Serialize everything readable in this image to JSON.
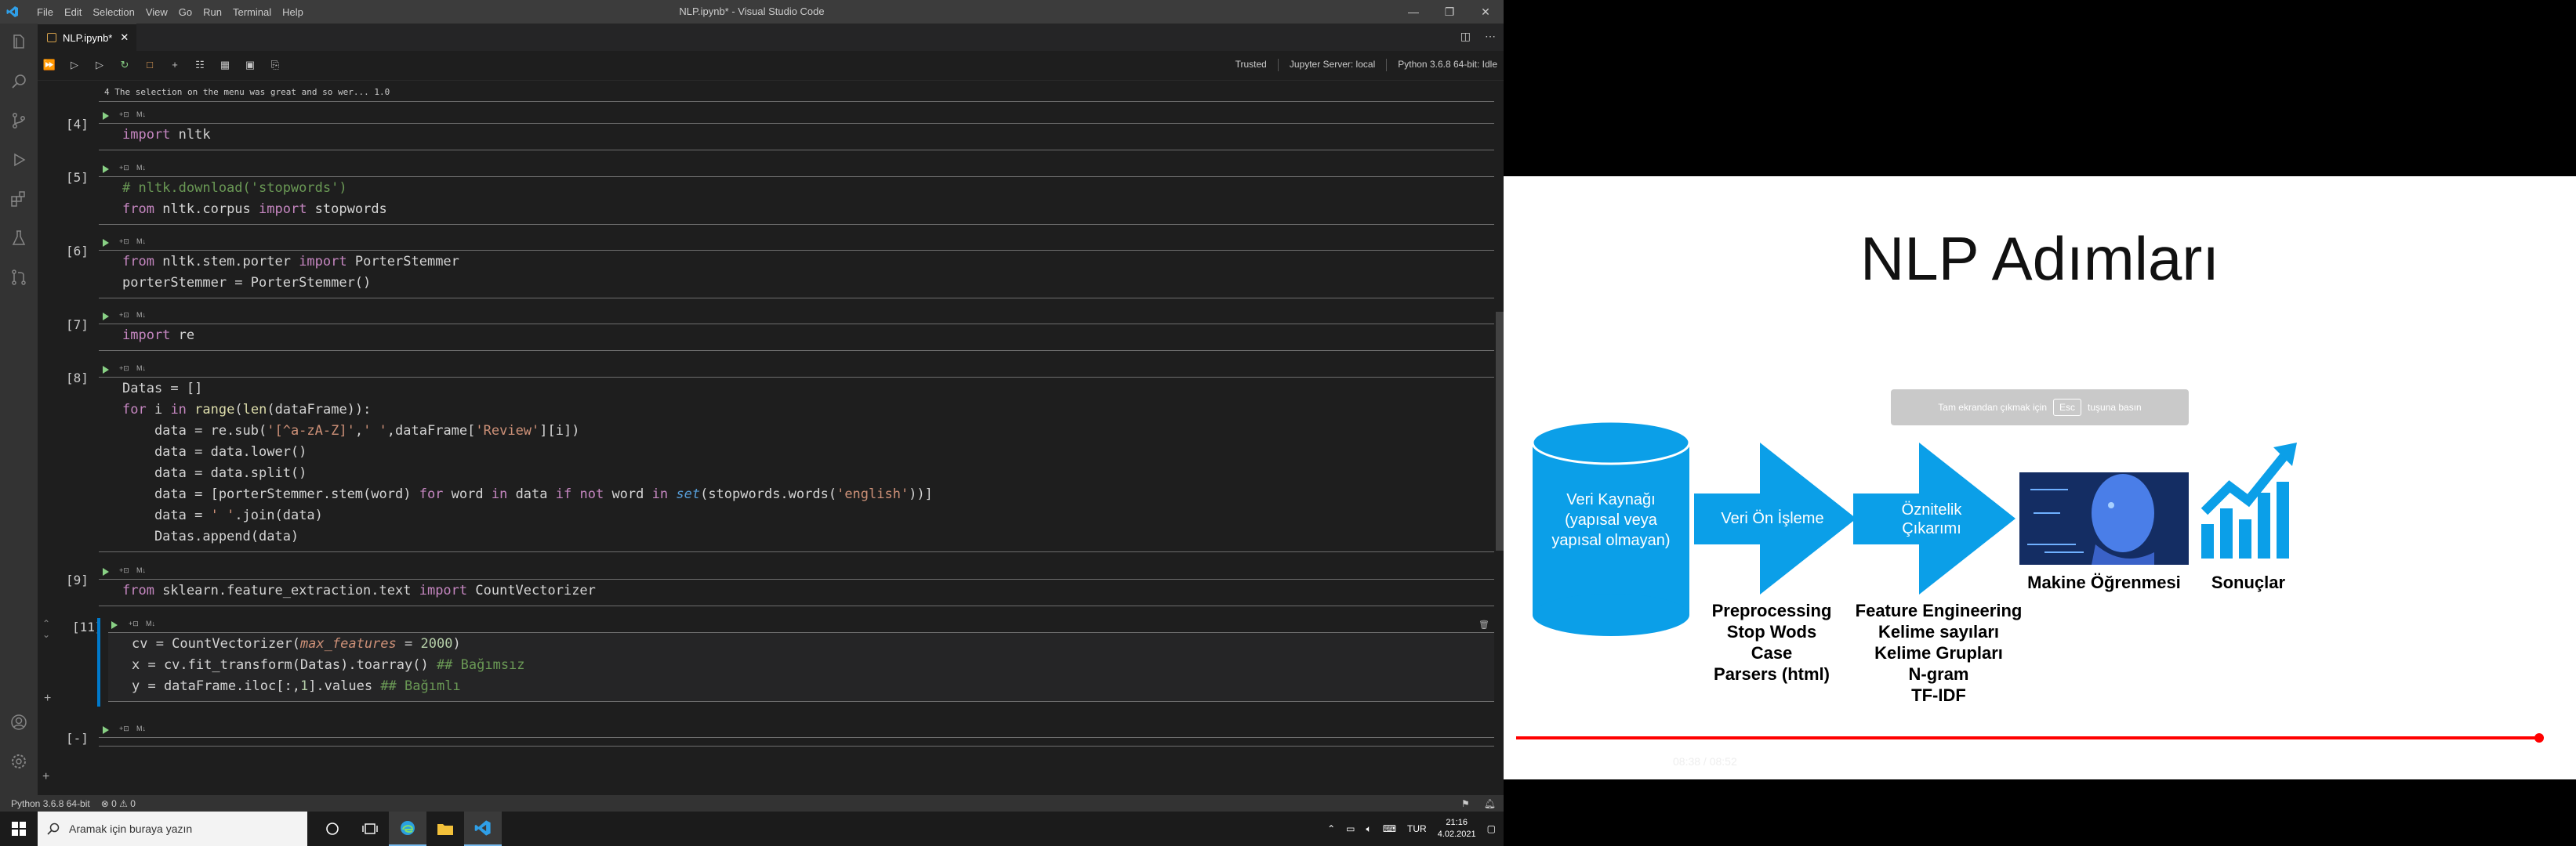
{
  "window": {
    "title": "NLP.ipynb* - Visual Studio Code",
    "menu": [
      "File",
      "Edit",
      "Selection",
      "View",
      "Go",
      "Run",
      "Terminal",
      "Help"
    ]
  },
  "tab": {
    "label": "NLP.ipynb*"
  },
  "notebook_status": {
    "trusted": "Trusted",
    "server": "Jupyter Server: local",
    "kernel": "Python 3.6.8 64-bit: Idle"
  },
  "output_line": "4  The selection on the menu was great and so wer...    1.0",
  "cells": [
    {
      "count": "[4]",
      "lines": [
        "import nltk"
      ]
    },
    {
      "count": "[5]",
      "lines": [
        "# nltk.download('stopwords')",
        "from nltk.corpus import stopwords"
      ]
    },
    {
      "count": "[6]",
      "lines": [
        "from nltk.stem.porter import PorterStemmer",
        "porterStemmer = PorterStemmer()"
      ]
    },
    {
      "count": "[7]",
      "lines": [
        "import re"
      ]
    },
    {
      "count": "[8]",
      "lines": [
        "Datas = []",
        "for i in range(len(dataFrame)):",
        "    data = re.sub('[^a-zA-Z]',' ',dataFrame['Review'][i])",
        "    data = data.lower()",
        "    data = data.split()",
        "    data = [porterStemmer.stem(word) for word in data if not word in set(stopwords.words('english'))]",
        "    data = ' '.join(data)",
        "    Datas.append(data)"
      ]
    },
    {
      "count": "[9]",
      "lines": [
        "from sklearn.feature_extraction.text import CountVectorizer"
      ]
    },
    {
      "count": "[11]",
      "lines": [
        "cv = CountVectorizer(max_features = 2000)",
        "x = cv.fit_transform(Datas).toarray() ## Bağımsız",
        "y = dataFrame.iloc[:,1].values ## Bağımlı"
      ]
    },
    {
      "count": "[-]",
      "lines": []
    }
  ],
  "md_label": "M↓",
  "statusbar": {
    "python": "Python 3.6.8 64-bit",
    "problems": "⊗ 0 ⚠ 0"
  },
  "taskbar": {
    "search_placeholder": "Aramak için buraya yazın",
    "language": "TUR",
    "time": "21:16",
    "date": "4.02.2021"
  },
  "slide": {
    "title": "NLP Adımları",
    "esc_banner_pre": "Tam ekrandan çıkmak için",
    "esc_key": "Esc",
    "esc_banner_post": "tuşuna basın",
    "db_text": [
      "Veri Kaynağı",
      "(yapısal veya",
      "yapısal olmayan)"
    ],
    "arrow1_text": "Veri Ön İşleme",
    "arrow2_text": [
      "Öznitelik",
      "Çıkarımı"
    ],
    "preprocessing_labels": [
      "Preprocessing",
      "Stop Wods",
      "Case",
      "Parsers (html)"
    ],
    "feature_labels": [
      "Feature Engineering",
      "Kelime sayıları",
      "Kelime Grupları",
      "N-gram",
      "TF-IDF"
    ],
    "ml_label": "Makine Öğrenmesi",
    "results_label": "Sonuçlar",
    "colors": {
      "accent": "#0b9fe8"
    }
  },
  "player": {
    "time": "08:38 / 08:52",
    "progress": 0.9736
  }
}
